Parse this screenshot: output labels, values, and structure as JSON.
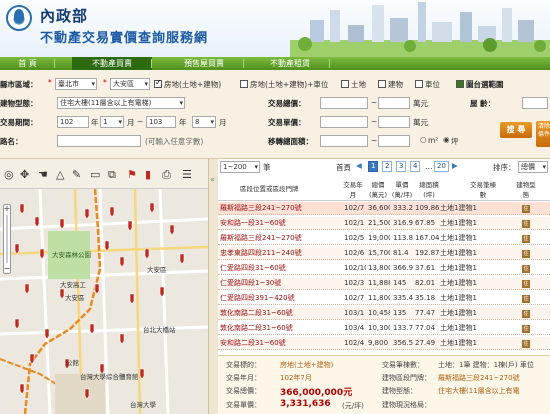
{
  "header": {
    "org": "內政部",
    "title": "不動產交易實價查詢服務網"
  },
  "nav": {
    "tabs": [
      "首 頁",
      "不動產買賣",
      "預售屋買賣",
      "不動產租賃"
    ],
    "active": 1
  },
  "filters": {
    "city_label": "縣市區域：",
    "city": "臺北市",
    "district": "大安區",
    "options": [
      "房地(土地+建物)",
      "房地(土地+建物)+車位",
      "土地",
      "建物",
      "車位"
    ],
    "options_checked": [
      true,
      false,
      false,
      false,
      false
    ],
    "map_select_label": "圖台選範圍",
    "building_type_label": "建物型態：",
    "building_type": "住宅大樓(11層含以上有電梯)",
    "total_price_label": "交易總價：",
    "price_unit": "萬元",
    "age_label": "屋  齡：",
    "period_label": "交易期間：",
    "from_year": "102",
    "from_month": "1",
    "to_year": "103",
    "to_month": "8",
    "year_unit": "年",
    "month_unit": "月",
    "tilde": "~",
    "unit_price_label": "交易單價：",
    "unit_price_unit": "萬元",
    "road_label": "路名：",
    "road_hint": "(可輸入任意字數)",
    "area_label": "移轉總面積：",
    "area_units": [
      "m²",
      "坪"
    ],
    "search_button": "搜 尋",
    "clear_button": "清除條件"
  },
  "map": {
    "labels": [
      "大安森林公園",
      "大安高工",
      "大安區",
      "大安區",
      "台北大橋站",
      "公館",
      "台灣大學綜合體育館",
      "台灣大學"
    ]
  },
  "results": {
    "page_size": "1~200",
    "page_size_unit": "筆",
    "first_page": "首頁",
    "pages": [
      "1",
      "2",
      "3",
      "4",
      "20"
    ],
    "current_page": "1",
    "sort_label": "排序：",
    "sort_value": "總價",
    "headers": [
      "區段位置或區段門牌",
      "交易年月",
      "總價(萬元)",
      "單價(萬/坪)",
      "總面積(坪)",
      "交易筆棟數",
      "建物型態"
    ],
    "rows": [
      {
        "addr": "羅斯福路三段241~270號",
        "date": "102/7",
        "total": "36,600",
        "unit": "333.2",
        "area": "109.86",
        "count": "土地1建物1",
        "type": "住"
      },
      {
        "addr": "安和路一段31~60號",
        "date": "102/1",
        "total": "21,500",
        "unit": "316.9",
        "area": "67.85",
        "count": "土地1建物1",
        "type": "住"
      },
      {
        "addr": "羅斯福路三段241~270號",
        "date": "102/5",
        "total": "19,000",
        "unit": "113.8",
        "area": "167.04",
        "count": "土地1建物1",
        "type": "住"
      },
      {
        "addr": "忠孝東路四段211~240號",
        "date": "102/6",
        "total": "15,700",
        "unit": "81.4",
        "area": "192.87",
        "count": "土地1建物1",
        "type": "住"
      },
      {
        "addr": "仁愛路四段31~60號",
        "date": "102/10",
        "total": "13,800",
        "unit": "366.9",
        "area": "37.61",
        "count": "土地1建物1",
        "type": "住"
      },
      {
        "addr": "仁愛路四段1~30號",
        "date": "102/3",
        "total": "11,888",
        "unit": "145",
        "area": "82.01",
        "count": "土地1建物1",
        "type": "住"
      },
      {
        "addr": "仁愛路四段391~420號",
        "date": "102/7",
        "total": "11,800",
        "unit": "335.4",
        "area": "35.18",
        "count": "土地1建物1",
        "type": "住"
      },
      {
        "addr": "敦化南路二段31~60號",
        "date": "103/1",
        "total": "10,458",
        "unit": "135",
        "area": "77.47",
        "count": "土地1建物1",
        "type": "住"
      },
      {
        "addr": "敦化南路二段31~60號",
        "date": "103/4",
        "total": "10,300",
        "unit": "133.7",
        "area": "77.04",
        "count": "土地1建物1",
        "type": "住"
      },
      {
        "addr": "安和路二段31~60號",
        "date": "102/4",
        "total": "9,800",
        "unit": "356.5",
        "area": "27.49",
        "count": "土地1建物1",
        "type": "住"
      }
    ]
  },
  "detail": {
    "type_label": "交易標的：",
    "type_value": "房地(土地+建物)",
    "date_label": "交易年月：",
    "date_value": "102年7月",
    "total_label": "交易總價：",
    "total_value": "366,000,000元",
    "unit_label": "交易單價：",
    "unit_value": "3,331,636",
    "unit_suffix": "(元/坪)",
    "count_label": "交易筆棟數：",
    "count_value": "土地：1筆 建物：1棟(戶) 車位",
    "addr_label": "建物區段門牌：",
    "addr_value": "羅斯福路三段241~270號",
    "use_label": "建物現況格局：",
    "use2_label": "建物型態：",
    "use2_value": "住宅大樓(11層含以上有電",
    "use_value": ""
  },
  "colors": {
    "nav_green": "#4f8f1c",
    "marker_red": "#c0281e",
    "route_orange": "#e98a1e",
    "accent_brown": "#b06010"
  }
}
